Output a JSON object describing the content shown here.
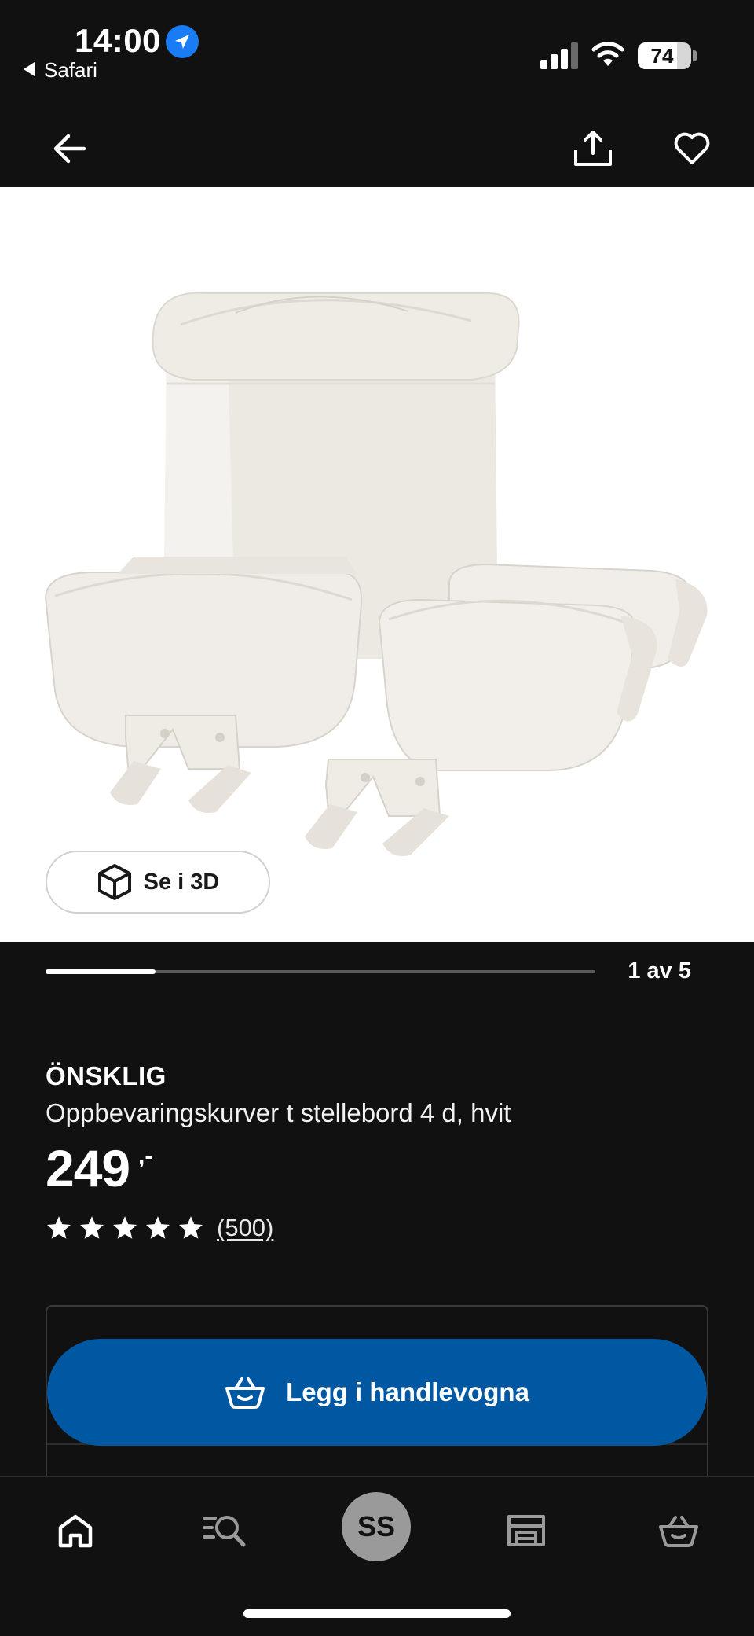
{
  "status_bar": {
    "time": "14:00",
    "back_app": "Safari",
    "battery_percent": 74,
    "battery_label": "74",
    "icons": [
      "location-arrow-icon",
      "signal-icon",
      "wifi-icon",
      "battery-icon"
    ]
  },
  "top_nav": {
    "icons": [
      "back-arrow-icon",
      "share-icon",
      "heart-icon"
    ]
  },
  "gallery": {
    "see_3d_label": "Se i 3D",
    "position_label": "1 av 5",
    "progress": 0.2
  },
  "product": {
    "brand": "ÖNSKLIG",
    "description": "Oppbevaringskurver t stellebord 4 d, hvit",
    "price": "249",
    "price_suffix": ",-",
    "rating": 5,
    "review_count": "(500)"
  },
  "actions": {
    "add_to_cart_label": "Legg i handlevogna"
  },
  "bottom_nav": {
    "avatar_initials": "SS",
    "tabs": [
      "home-icon",
      "search-list-icon",
      "profile-avatar",
      "store-icon",
      "cart-icon"
    ]
  },
  "colors": {
    "background": "#111111",
    "primary_button": "#0058a3",
    "location_badge": "#1a7cf5"
  }
}
